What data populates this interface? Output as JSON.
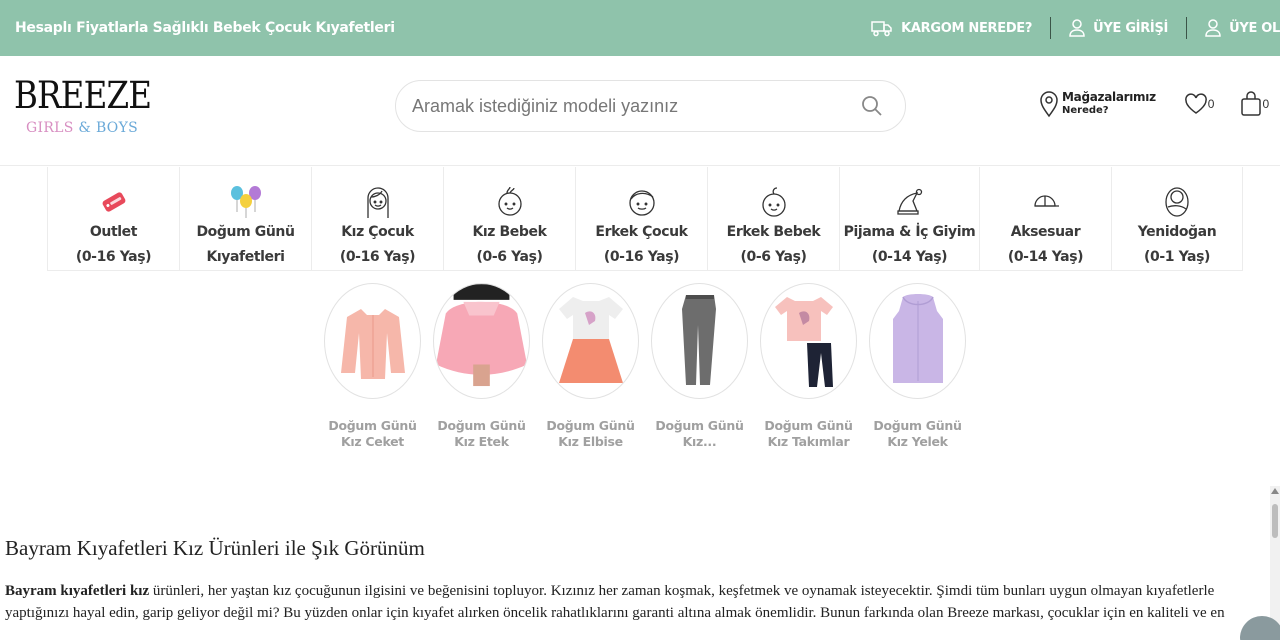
{
  "topbar": {
    "slogan": "Hesaplı Fiyatlarla Sağlıklı Bebek Çocuk Kıyafetleri",
    "links": [
      {
        "label": "KARGOM NEREDE?",
        "icon": "truck-icon"
      },
      {
        "label": "ÜYE GİRİŞİ",
        "icon": "user-icon"
      },
      {
        "label": "ÜYE OL",
        "icon": "user-icon"
      }
    ]
  },
  "header": {
    "logo": {
      "brand": "BREEZE",
      "sub_girls": "GIRLS",
      "sub_amp": "&",
      "sub_boys": "BOYS"
    },
    "search_placeholder": "Aramak istediğiniz modeli yazınız",
    "store_line1": "Mağazalarımız",
    "store_line2": "Nerede?",
    "favorites_count": "0",
    "cart_count": "0"
  },
  "categories": [
    {
      "line1": "Outlet",
      "line2": "(0-16 Yaş)",
      "icon": "outlet-tag-icon"
    },
    {
      "line1": "Doğum Günü",
      "line2": "Kıyafetleri",
      "icon": "balloons-icon"
    },
    {
      "line1": "Kız Çocuk",
      "line2": "(0-16 Yaş)",
      "icon": "girl-face-icon"
    },
    {
      "line1": "Kız Bebek",
      "line2": "(0-6 Yaş)",
      "icon": "baby-girl-face-icon"
    },
    {
      "line1": "Erkek Çocuk",
      "line2": "(0-16 Yaş)",
      "icon": "boy-face-icon"
    },
    {
      "line1": "Erkek Bebek",
      "line2": "(0-6 Yaş)",
      "icon": "baby-boy-face-icon"
    },
    {
      "line1": "Pijama & İç Giyim",
      "line2": "(0-14 Yaş)",
      "icon": "sleep-cap-icon"
    },
    {
      "line1": "Aksesuar",
      "line2": "(0-14 Yaş)",
      "icon": "cap-icon"
    },
    {
      "line1": "Yenidoğan",
      "line2": "(0-1 Yaş)",
      "icon": "swaddled-baby-icon"
    }
  ],
  "subcategories": [
    {
      "line1": "Doğum Günü",
      "line2": "Kız Ceket",
      "image": "pink-jacket"
    },
    {
      "line1": "Doğum Günü",
      "line2": "Kız Etek",
      "image": "pink-tutu-skirt"
    },
    {
      "line1": "Doğum Günü",
      "line2": "Kız Elbise",
      "image": "unicorn-dress"
    },
    {
      "line1": "Doğum Günü",
      "line2": "Kız...",
      "image": "grey-trousers"
    },
    {
      "line1": "Doğum Günü",
      "line2": "Kız Takımlar",
      "image": "unicorn-set"
    },
    {
      "line1": "Doğum Günü",
      "line2": "Kız Yelek",
      "image": "lilac-vest"
    }
  ],
  "article": {
    "title": "Bayram Kıyafetleri Kız Ürünleri ile Şık Görünüm",
    "bold": "Bayram kıyafetleri kız",
    "line1_rest": " ürünleri, her yaştan kız çocuğunun ilgisini ve beğenisini topluyor. Kızınız her zaman koşmak, keşfetmek ve oynamak isteyecektir. Şimdi tüm bunları uygun olmayan kıyafetlerle",
    "line2": "yaptığınızı hayal edin, garip geliyor değil mi? Bu yüzden onlar için kıyafet alırken öncelik rahatlıklarını garanti altına almak önemlidir. Bunun farkında olan Breeze markası, çocuklar için en kaliteli ve en"
  },
  "colors": {
    "topbar": "#8fc3ab",
    "label_grey": "#a0a0a0",
    "logo_pink": "#d88fc2",
    "logo_blue": "#6aa9d8"
  }
}
